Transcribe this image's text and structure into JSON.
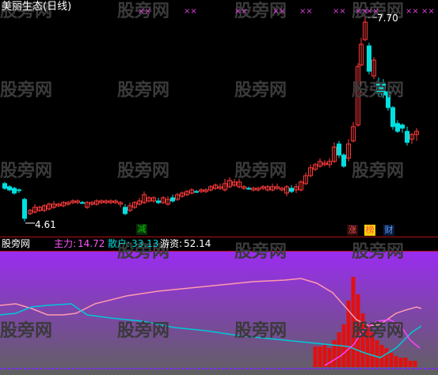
{
  "header": {
    "title": "美丽生态(日线)"
  },
  "price_panel": {
    "high_label": "7.70",
    "low_label": "4.61",
    "marker": "××",
    "tags": [
      {
        "text": "减",
        "color": "#00d000",
        "bg": "#0b2a0b"
      },
      {
        "text": "涨",
        "color": "#ff5050",
        "bg": "#2a0b0b"
      },
      {
        "text": "榜",
        "color": "#ff5050",
        "bg": "#ffd000"
      },
      {
        "text": "财",
        "color": "#5aa0ff",
        "bg": "#0b1a3a"
      }
    ]
  },
  "indicator_panel": {
    "name": "股旁网",
    "items": [
      {
        "label": "主力:",
        "value": "14.72",
        "color": "#ff55ff"
      },
      {
        "label": "散户:",
        "value": "33.13",
        "color": "#00d8d8"
      },
      {
        "label": "游资:",
        "value": "52.14",
        "color": "#ffffff"
      }
    ]
  },
  "watermark": "股旁网",
  "colors": {
    "up": "#ff3a3a",
    "down": "#00e0e0",
    "cyan_line": "#00c8d8",
    "pink_line": "#ff9ab0",
    "magenta_line": "#ff40ff",
    "red_bar": "#e01010",
    "bg_top": "#9a2cf0",
    "bg_bottom": "#606060"
  }
}
